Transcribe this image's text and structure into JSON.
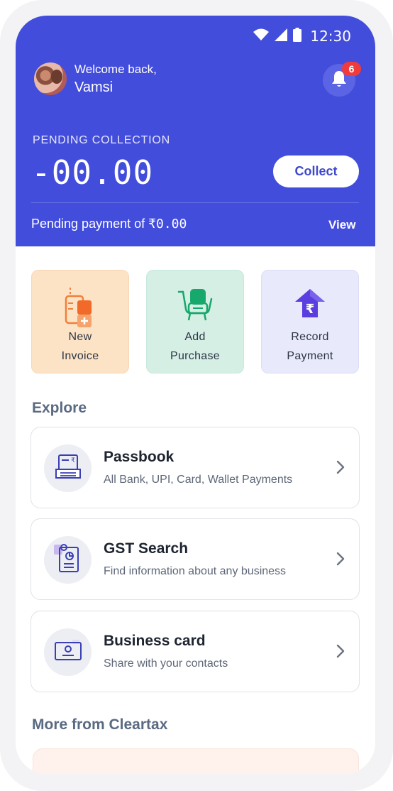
{
  "status": {
    "time": "12:30"
  },
  "header": {
    "welcome": "Welcome back,",
    "username": "Vamsi",
    "notification_count": "6",
    "pending_label": "PENDING COLLECTION",
    "pending_amount": "-00.00",
    "collect_label": "Collect",
    "pending_payment_prefix": "Pending payment of ",
    "pending_payment_amount": "₹0.00",
    "view_label": "View"
  },
  "actions": [
    {
      "line1": "New",
      "line2": "Invoice",
      "icon": "invoice-icon"
    },
    {
      "line1": "Add",
      "line2": "Purchase",
      "icon": "cart-icon"
    },
    {
      "line1": "Record",
      "line2": "Payment",
      "icon": "rupee-upload-icon"
    }
  ],
  "explore": {
    "title": "Explore",
    "items": [
      {
        "title": "Passbook",
        "subtitle": "All Bank, UPI, Card, Wallet Payments",
        "icon": "passbook-icon"
      },
      {
        "title": "GST Search",
        "subtitle": "Find information about any business",
        "icon": "gst-document-icon"
      },
      {
        "title": "Business card",
        "subtitle": "Share with your contacts",
        "icon": "business-card-icon"
      }
    ]
  },
  "more": {
    "title": "More from Cleartax"
  },
  "colors": {
    "brand": "#434ddb",
    "badge": "#ef3b3b",
    "invoice_tile": "#fde3c5",
    "purchase_tile": "#d5efe5",
    "payment_tile": "#e8e9fb"
  }
}
